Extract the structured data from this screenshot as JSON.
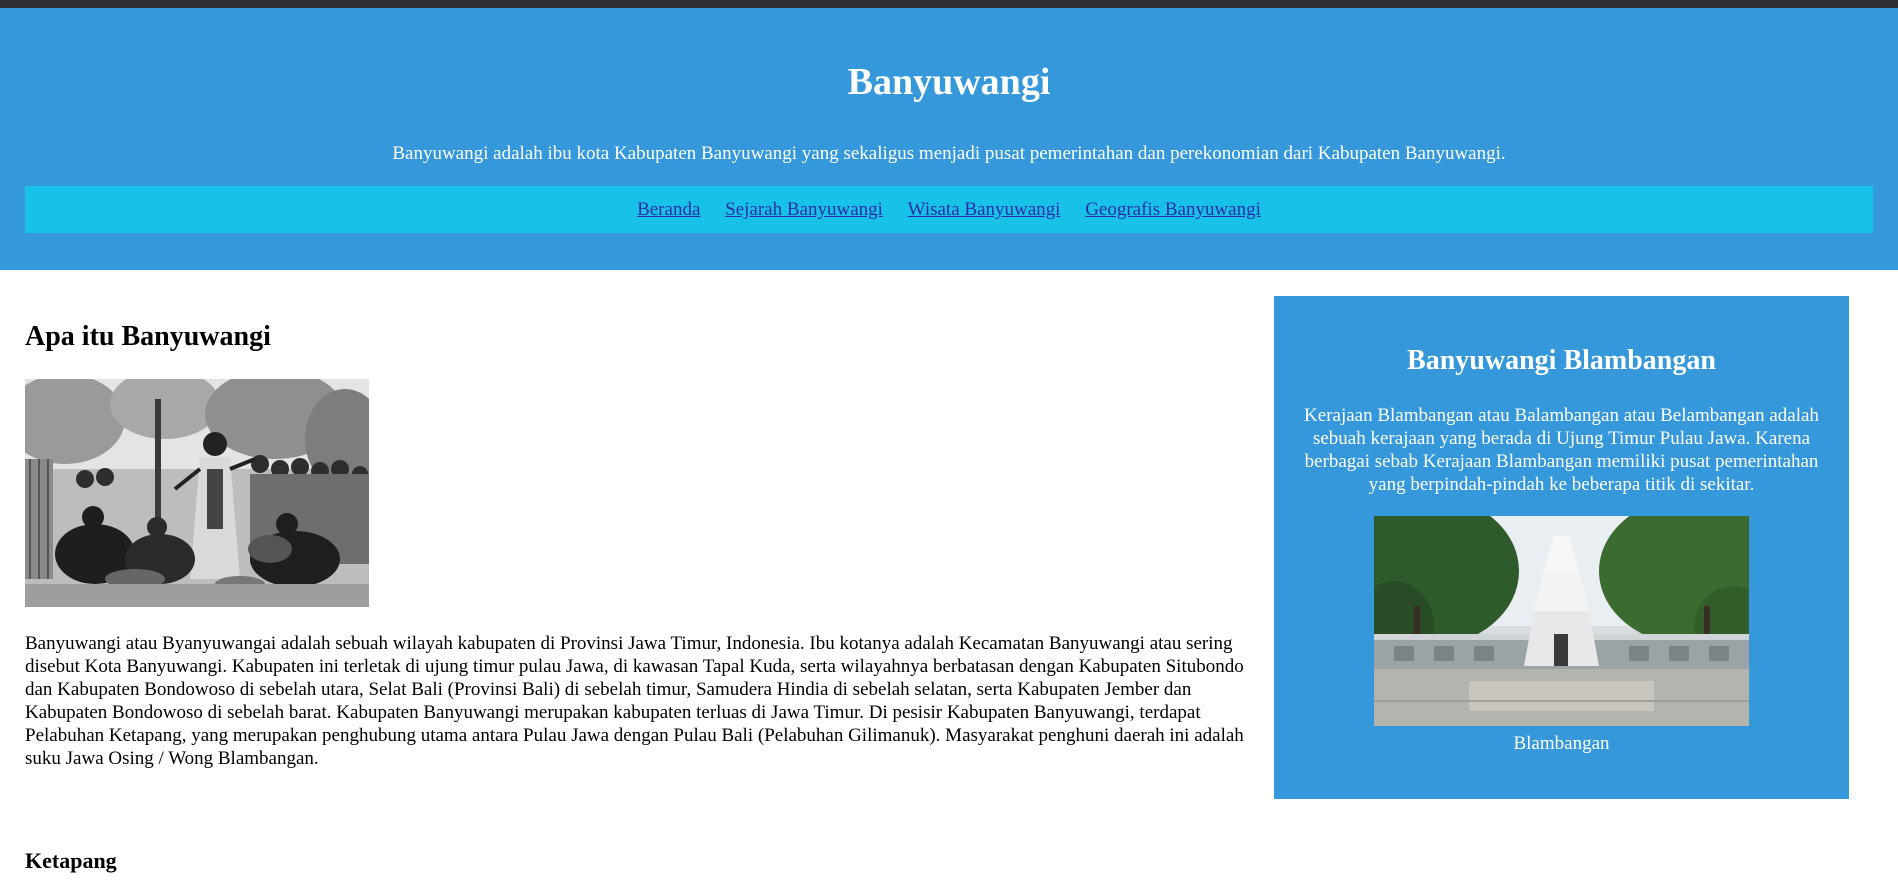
{
  "header": {
    "title": "Banyuwangi",
    "tagline": "Banyuwangi adalah ibu kota Kabupaten Banyuwangi yang sekaligus menjadi pusat pemerintahan dan perekonomian dari Kabupaten Banyuwangi."
  },
  "nav": {
    "items": [
      {
        "label": "Beranda"
      },
      {
        "label": "Sejarah Banyuwangi"
      },
      {
        "label": "Wisata Banyuwangi"
      },
      {
        "label": "Geografis Banyuwangi"
      }
    ]
  },
  "main": {
    "heading": "Apa itu Banyuwangi",
    "body": "Banyuwangi atau Byanyuwangai adalah sebuah wilayah kabupaten di Provinsi Jawa Timur, Indonesia. Ibu kotanya adalah Kecamatan Banyuwangi atau sering disebut Kota Banyuwangi. Kabupaten ini terletak di ujung timur pulau Jawa, di kawasan Tapal Kuda, serta wilayahnya berbatasan dengan Kabupaten Situbondo dan Kabupaten Bondowoso di sebelah utara, Selat Bali (Provinsi Bali) di sebelah timur, Samudera Hindia di sebelah selatan, serta Kabupaten Jember dan Kabupaten Bondowoso di sebelah barat. Kabupaten Banyuwangi merupakan kabupaten terluas di Jawa Timur. Di pesisir Kabupaten Banyuwangi, terdapat Pelabuhan Ketapang, yang merupakan penghubung utama antara Pulau Jawa dengan Pulau Bali (Pelabuhan Gilimanuk). Masyarakat penghuni daerah ini adalah suku Jawa Osing / Wong Blambangan.",
    "subheading": "Ketapang"
  },
  "aside": {
    "heading": "Banyuwangi Blambangan",
    "body": "Kerajaan Blambangan atau Balambangan atau Belambangan adalah sebuah kerajaan yang berada di Ujung Timur Pulau Jawa. Karena berbagai sebab Kerajaan Blambangan memiliki pusat pemerintahan yang berpindah-pindah ke beberapa titik di sekitar.",
    "caption": "Blambangan"
  },
  "colors": {
    "header_bg": "#3498db",
    "nav_bg": "#17c1e8",
    "link": "#2b2ea8",
    "aside_bg": "#3498db"
  }
}
